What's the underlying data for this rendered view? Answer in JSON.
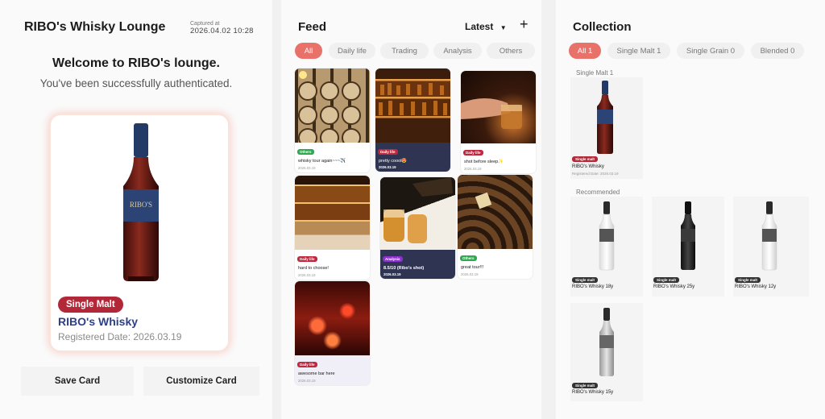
{
  "left": {
    "app_title": "RIBO's Whisky Lounge",
    "captured_label": "Captured at",
    "captured_time": "2026.04.02 10:28",
    "welcome": "Welcome to RIBO's lounge.",
    "auth_message": "You've been successfully authenticated.",
    "card": {
      "badge": "Single Malt",
      "name": "RIBO's Whisky",
      "registered": "Registered Date: 2026.03.19",
      "bottle_label": "RIBO'S"
    },
    "save_button": "Save Card",
    "customize_button": "Customize Card"
  },
  "feed": {
    "title": "Feed",
    "sort": "Latest",
    "sort_icon": "caret-down-icon",
    "add_icon": "plus-icon",
    "filters": [
      "All",
      "Daily life",
      "Trading",
      "Analysis",
      "Others"
    ],
    "active_filter": "All",
    "posts": [
      {
        "tag": "Others",
        "text": "whisky tour again~~~✈️",
        "date": "2026.03.19"
      },
      {
        "tag": "Daily life",
        "text": "pretty coool😍",
        "date": "2026.03.19"
      },
      {
        "tag": "Daily life",
        "text": "shot before sleep✨",
        "date": "2026.03.19"
      },
      {
        "tag": "Daily life",
        "text": "hard to choose!",
        "date": "2026.03.19"
      },
      {
        "tag": "Analysis",
        "text": "8.5/10 (Ribo's shot)",
        "date": "2026.03.19"
      },
      {
        "tag": "Others",
        "text": "great tour!!!",
        "date": "2026.03.19"
      },
      {
        "tag": "Daily life",
        "text": "awesome bar here",
        "date": "2026.03.19"
      }
    ],
    "tag_colors": {
      "Others": "#2fa84f",
      "Daily life": "#c0283e",
      "Analysis": "#8e2fd0"
    }
  },
  "collection": {
    "title": "Collection",
    "filters": [
      "All 1",
      "Single Malt 1",
      "Single Grain 0",
      "Blended 0"
    ],
    "active_filter": "All 1",
    "section_label": "Single Malt 1",
    "owned": {
      "badge": "Single malt",
      "name": "RIBO's Whisky",
      "registered": "Registered Date: 2026.03.19"
    },
    "recommended_label": "Recommended",
    "recommended": [
      {
        "badge": "Single malt",
        "name": "RIBO's Whisky 18y"
      },
      {
        "badge": "Single malt",
        "name": "RIBO's Whisky 25y"
      },
      {
        "badge": "Single malt",
        "name": "RIBO's Whisky 12y"
      },
      {
        "badge": "Single malt",
        "name": "RIBO's Whisky 15y"
      }
    ]
  },
  "colors": {
    "accent": "#e8716a",
    "badge_red": "#b32838",
    "navy": "#2e3f8a"
  }
}
